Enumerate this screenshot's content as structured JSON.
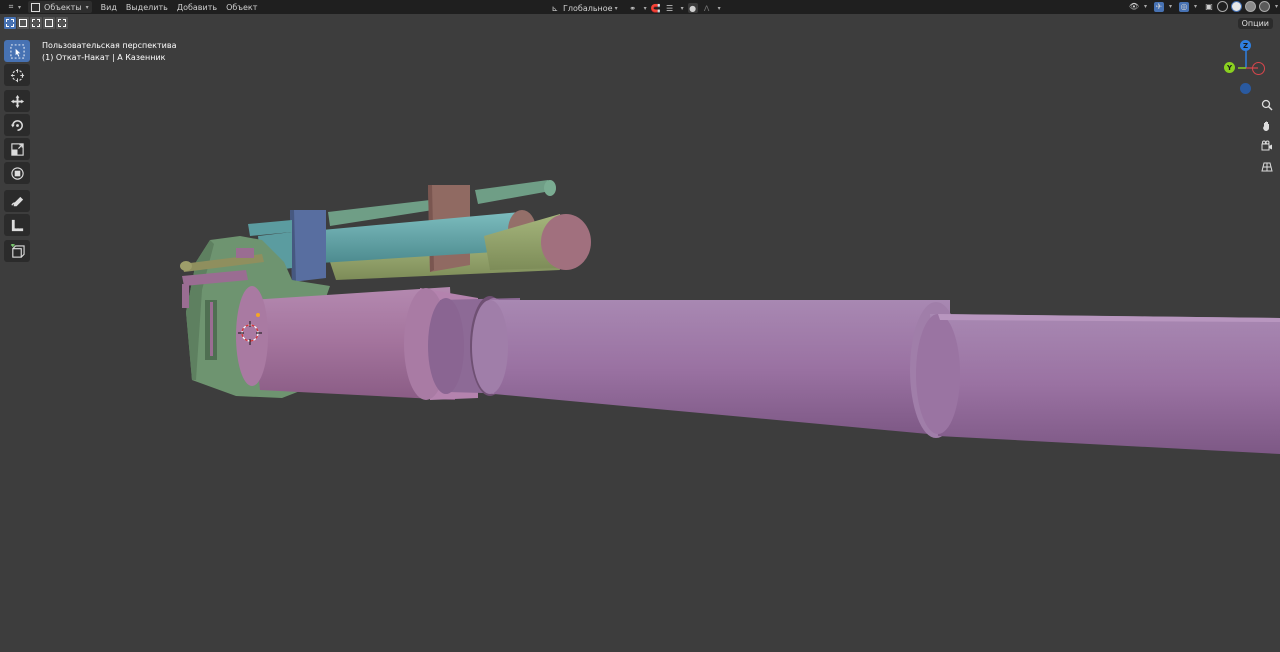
{
  "header": {
    "editor_type_icon": "view3d-icon",
    "mode_label": "Объекты",
    "menus": [
      "Вид",
      "Выделить",
      "Добавить",
      "Объект"
    ],
    "transform_orientation": "Глобальное"
  },
  "toolbar_row": {
    "options_label": "Опции"
  },
  "viewport": {
    "view_label": "Пользовательская перспектива",
    "object_label": "(1) Откат-Накат | А Казенник"
  },
  "tools": [
    {
      "name": "select-box-tool",
      "icon": "cursor-icon"
    },
    {
      "name": "cursor-tool",
      "icon": "cursor-target-icon"
    },
    {
      "name": "move-tool",
      "icon": "move-icon"
    },
    {
      "name": "rotate-tool",
      "icon": "rotate-icon"
    },
    {
      "name": "scale-tool",
      "icon": "scale-icon"
    },
    {
      "name": "transform-tool",
      "icon": "transform-icon"
    },
    {
      "name": "annotate-tool",
      "icon": "annotate-icon"
    },
    {
      "name": "measure-tool",
      "icon": "measure-icon"
    },
    {
      "name": "add-cube-tool",
      "icon": "add-cube-icon"
    }
  ],
  "gizmo": {
    "z_label": "Z",
    "y_label": "Y",
    "colors": {
      "x": "#d8464c",
      "y": "#8ad020",
      "z": "#2f7fe0",
      "neg": "#2a5aa0"
    }
  },
  "colors": {
    "background": "#3d3d3d",
    "header": "#1f1f1f",
    "accent": "#4772b3",
    "barrel": "#a2709a",
    "barrel_light": "#b58bb1",
    "sleeve": "#8d6a96",
    "breech_green": "#6e9470",
    "rod_teal": "#5b9ca0",
    "rod_olive": "#8fa06a",
    "plate_blue": "#586ea0",
    "plate_brown": "#906a62"
  }
}
